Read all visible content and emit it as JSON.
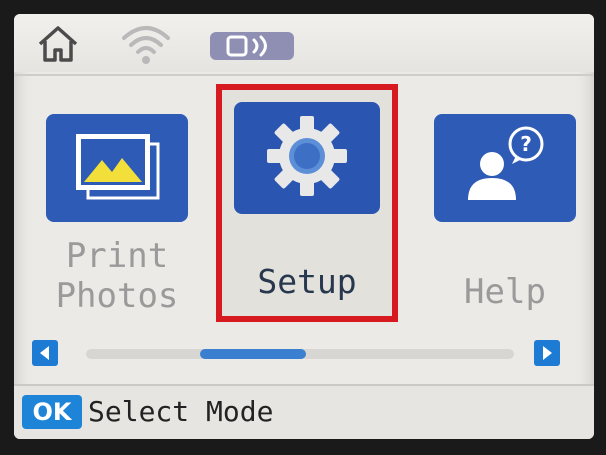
{
  "colors": {
    "tile_blue": "#2d5bb6",
    "selection_red": "#d61a20",
    "accent_blue": "#1e84d8"
  },
  "status_bar": {
    "icons": [
      "home-icon",
      "wifi-icon",
      "nfc-icon"
    ]
  },
  "menu": {
    "items": [
      {
        "label_line1": "Print",
        "label_line2": "Photos",
        "icon": "photo-icon",
        "selected": false
      },
      {
        "label": "Setup",
        "icon": "gear-icon",
        "selected": true
      },
      {
        "label": "Help",
        "icon": "help-person-icon",
        "selected": false
      }
    ]
  },
  "scrollbar": {
    "left_icon": "arrow-left-icon",
    "right_icon": "arrow-right-icon",
    "position": 0.4
  },
  "footer": {
    "ok_label": "OK",
    "hint": "Select Mode"
  }
}
